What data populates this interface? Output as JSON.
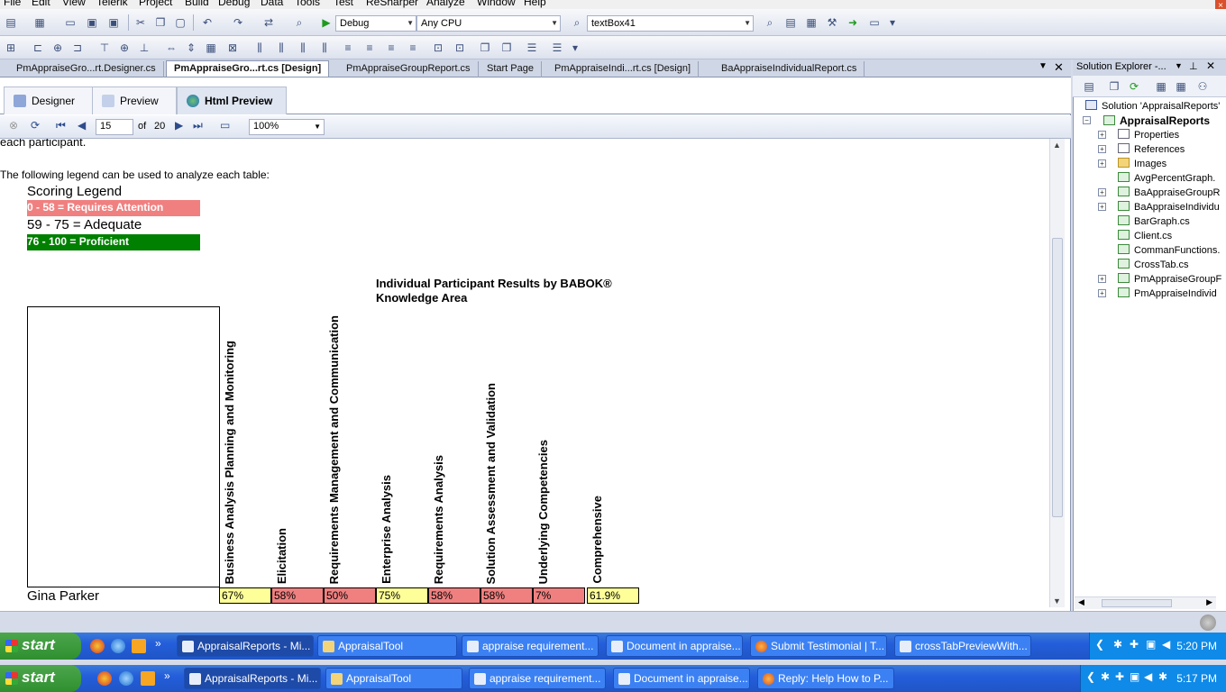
{
  "menu": {
    "items": [
      "File",
      "Edit",
      "View",
      "Telerik",
      "Project",
      "Build",
      "Debug",
      "Data",
      "Tools",
      "Test",
      "ReSharper",
      "Analyze",
      "Window",
      "Help"
    ]
  },
  "toolbar": {
    "config": "Debug",
    "platform": "Any CPU",
    "find_target": "textBox41"
  },
  "doc_tabs": [
    "PmAppraiseGro...rt.Designer.cs",
    "PmAppraiseGro...rt.cs [Design]",
    "PmAppraiseGroupReport.cs",
    "Start Page",
    "PmAppraiseIndi...rt.cs [Design]",
    "BaAppraiseIndividualReport.cs"
  ],
  "view_tabs": {
    "designer": "Designer",
    "preview": "Preview",
    "html_preview": "Html Preview"
  },
  "preview_bar": {
    "page": "15",
    "of_label": "of",
    "total": "20",
    "zoom": "100%"
  },
  "report": {
    "intro_tail": "each participant.",
    "legend_intro": "The following legend can be used to analyze each table:",
    "legend_title": "Scoring Legend",
    "legend": {
      "attention": "0 - 58 = Requires Attention",
      "adequate": "59 - 75 = Adequate",
      "proficient": "76 - 100 = Proficient"
    },
    "chart_title": "Individual Participant Results by BABOK® Knowledge Area",
    "columns": [
      "Business Analysis Planning and Monitoring",
      "Elicitation",
      "Requirements Management and Communication",
      "Enterprise Analysis",
      "Requirements Analysis",
      "Solution Assessment and Validation",
      "Underlying Competencies",
      "Comprehensive"
    ],
    "row": {
      "name": "Gina Parker",
      "values": [
        "67%",
        "58%",
        "50%",
        "75%",
        "58%",
        "58%",
        "7%",
        "61.9%"
      ]
    },
    "colors": {
      "attention": "#f08080",
      "adequate": "#ffff99",
      "proficient": "#008000"
    }
  },
  "solution_explorer": {
    "title": "Solution Explorer -...",
    "solution": "Solution 'AppraisalReports'",
    "project": "AppraisalReports",
    "items": [
      "Properties",
      "References",
      "Images",
      "AvgPercentGraph.",
      "BaAppraiseGroupR",
      "BaAppraiseIndividu",
      "BarGraph.cs",
      "Client.cs",
      "CommanFunctions.",
      "CrossTab.cs",
      "PmAppraiseGroupF",
      "PmAppraiseIndivid"
    ]
  },
  "taskbar1": {
    "start": "start",
    "buttons": [
      "AppraisalReports - Mi...",
      "AppraisalTool",
      "appraise requirement...",
      "Document in appraise...",
      "Submit Testimonial | T...",
      "crossTabPreviewWith..."
    ],
    "clock": "5:20 PM"
  },
  "taskbar2": {
    "start": "start",
    "buttons": [
      "AppraisalReports - Mi...",
      "AppraisalTool",
      "appraise requirement...",
      "Document in appraise...",
      "Reply: Help How to P..."
    ],
    "clock": "5:17 PM"
  }
}
